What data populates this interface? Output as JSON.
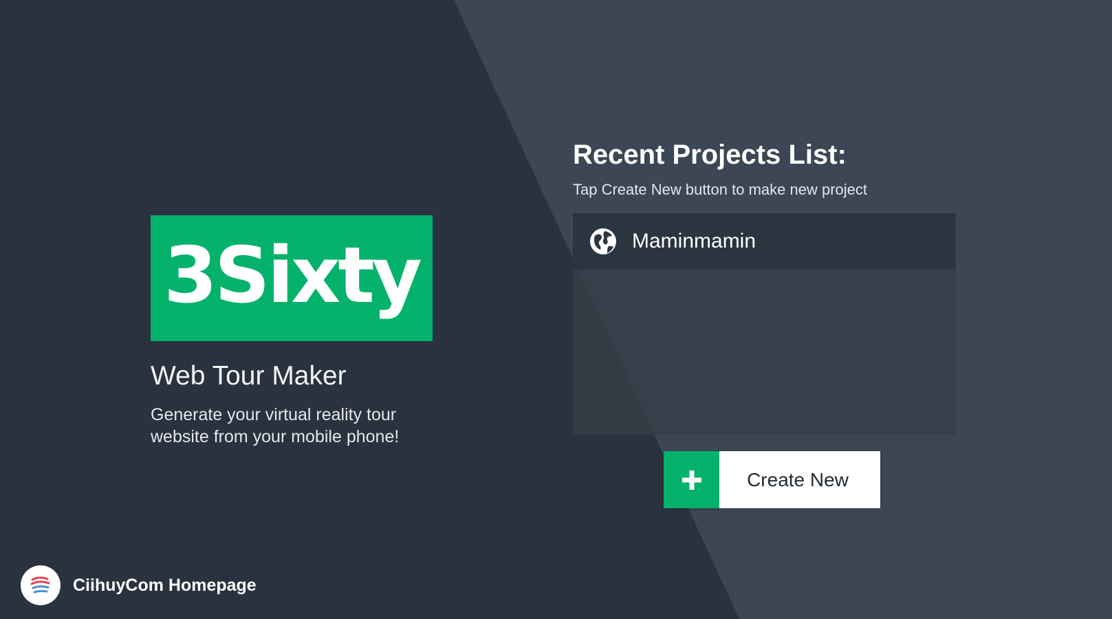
{
  "colors": {
    "background_light": "#3c4654",
    "background_dark": "#29323e",
    "accent": "#04b26b",
    "text_primary": "#ffffff"
  },
  "brand": {
    "logo_text": "3Sixty",
    "subtitle": "Web Tour Maker",
    "description": "Generate your virtual reality tour website from your mobile phone!"
  },
  "recent_projects": {
    "title": "Recent Projects List:",
    "hint": "Tap Create New button to make new project",
    "items": [
      {
        "name": "Maminmamin",
        "icon": "globe-icon"
      }
    ]
  },
  "create_button": {
    "icon": "plus-icon",
    "label": "Create New"
  },
  "homepage_link": {
    "icon": "ciihuycom-logo",
    "label": "CiihuyCom Homepage"
  }
}
